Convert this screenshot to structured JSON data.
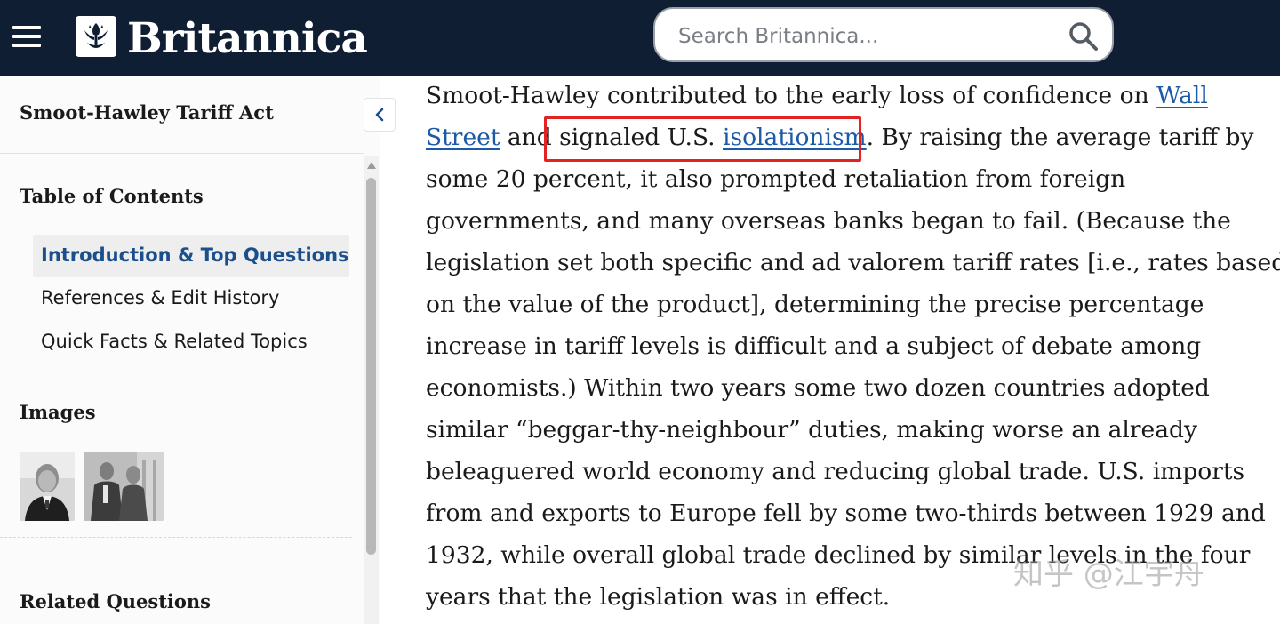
{
  "header": {
    "logo_text": "Britannica",
    "search_placeholder": "Search Britannica..."
  },
  "sidebar": {
    "article_title": "Smoot-Hawley Tariff Act",
    "toc_heading": "Table of Contents",
    "toc_items": [
      {
        "label": "Introduction & Top Questions",
        "active": true
      },
      {
        "label": "References & Edit History",
        "active": false
      },
      {
        "label": "Quick Facts & Related Topics",
        "active": false
      }
    ],
    "images_heading": "Images",
    "related_heading": "Related Questions"
  },
  "article": {
    "l1_text": "Smoot-Hawley contributed to the early loss of confidence on ",
    "l1_link": "Wall",
    "l2_link": "Street",
    "l2_mid": " and signaled U.S. ",
    "l2_link2": "isolationism",
    "l2_tail": ". By raising the average tariff by",
    "lines": [
      "some 20 percent, it also prompted retaliation from foreign",
      "governments, and many overseas banks began to fail. (Because the",
      "legislation set both specific and ad valorem tariff rates [i.e., rates based",
      "on the value of the product], determining the precise percentage",
      "increase in tariff levels is difficult and a subject of debate among",
      "economists.) Within two years some two dozen countries adopted",
      "similar “beggar-thy-neighbour” duties, making worse an already",
      "beleaguered world economy and reducing global trade. U.S. imports",
      "from and exports to Europe fell by some two-thirds between 1929 and",
      "1932, while overall global trade declined by similar levels in the four",
      "years that the legislation was in effect."
    ]
  },
  "watermark": "知乎 @江宇舟",
  "colors": {
    "header_bg": "#0f1e33",
    "link": "#1b5aa6",
    "toc_active": "#1b4f8c",
    "highlight_box": "#e32222"
  },
  "icons": [
    "hamburger-icon",
    "britannica-thistle-logo",
    "search-icon",
    "chevron-left-icon"
  ]
}
